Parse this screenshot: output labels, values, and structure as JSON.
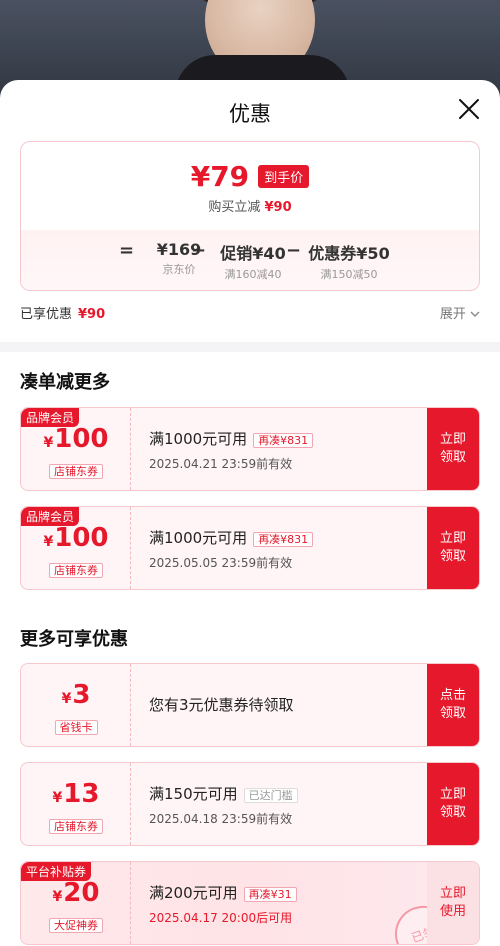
{
  "sheet": {
    "title": "优惠"
  },
  "price": {
    "current": "¥79",
    "tag": "到手价",
    "sub_label": "购买立减",
    "sub_value": "¥90"
  },
  "formula": {
    "eq": "=",
    "minus1": "−",
    "minus2": "−",
    "items": [
      {
        "value": "¥169",
        "label": "京东价"
      },
      {
        "value": "促销¥40",
        "label": "满160减40"
      },
      {
        "value": "优惠券¥50",
        "label": "满150减50"
      }
    ]
  },
  "enjoyed": {
    "label": "已享优惠",
    "value": "¥90"
  },
  "expand": {
    "label": "展开"
  },
  "section1": {
    "title": "凑单减更多"
  },
  "section2": {
    "title": "更多可享优惠"
  },
  "coupons": [
    {
      "badge": "品牌会员",
      "amount": "100",
      "currency": "¥",
      "kind": "店铺东券",
      "cond": "满1000元可用",
      "chip": "再凑¥831",
      "date": "2025.04.21 23:59前有效",
      "button": "立即领取"
    },
    {
      "badge": "品牌会员",
      "amount": "100",
      "currency": "¥",
      "kind": "店铺东券",
      "cond": "满1000元可用",
      "chip": "再凑¥831",
      "date": "2025.05.05 23:59前有效",
      "button": "立即领取"
    },
    {
      "badge": "",
      "amount": "3",
      "currency": "¥",
      "kind": "省钱卡",
      "cond": "您有3元优惠券待领取",
      "chip": "",
      "date": "",
      "button": "点击领取"
    },
    {
      "badge": "",
      "amount": "13",
      "currency": "¥",
      "kind": "店铺东券",
      "cond": "满150元可用",
      "chip": "已达门槛",
      "date": "2025.04.18 23:59前有效",
      "button": "立即领取"
    },
    {
      "badge": "平台补贴券",
      "amount": "20",
      "currency": "¥",
      "kind": "大促神券",
      "cond": "满200元可用",
      "chip": "再凑¥31",
      "date": "2025.04.17 20:00后可用",
      "button": "立即使用",
      "stamp": "已领"
    }
  ]
}
